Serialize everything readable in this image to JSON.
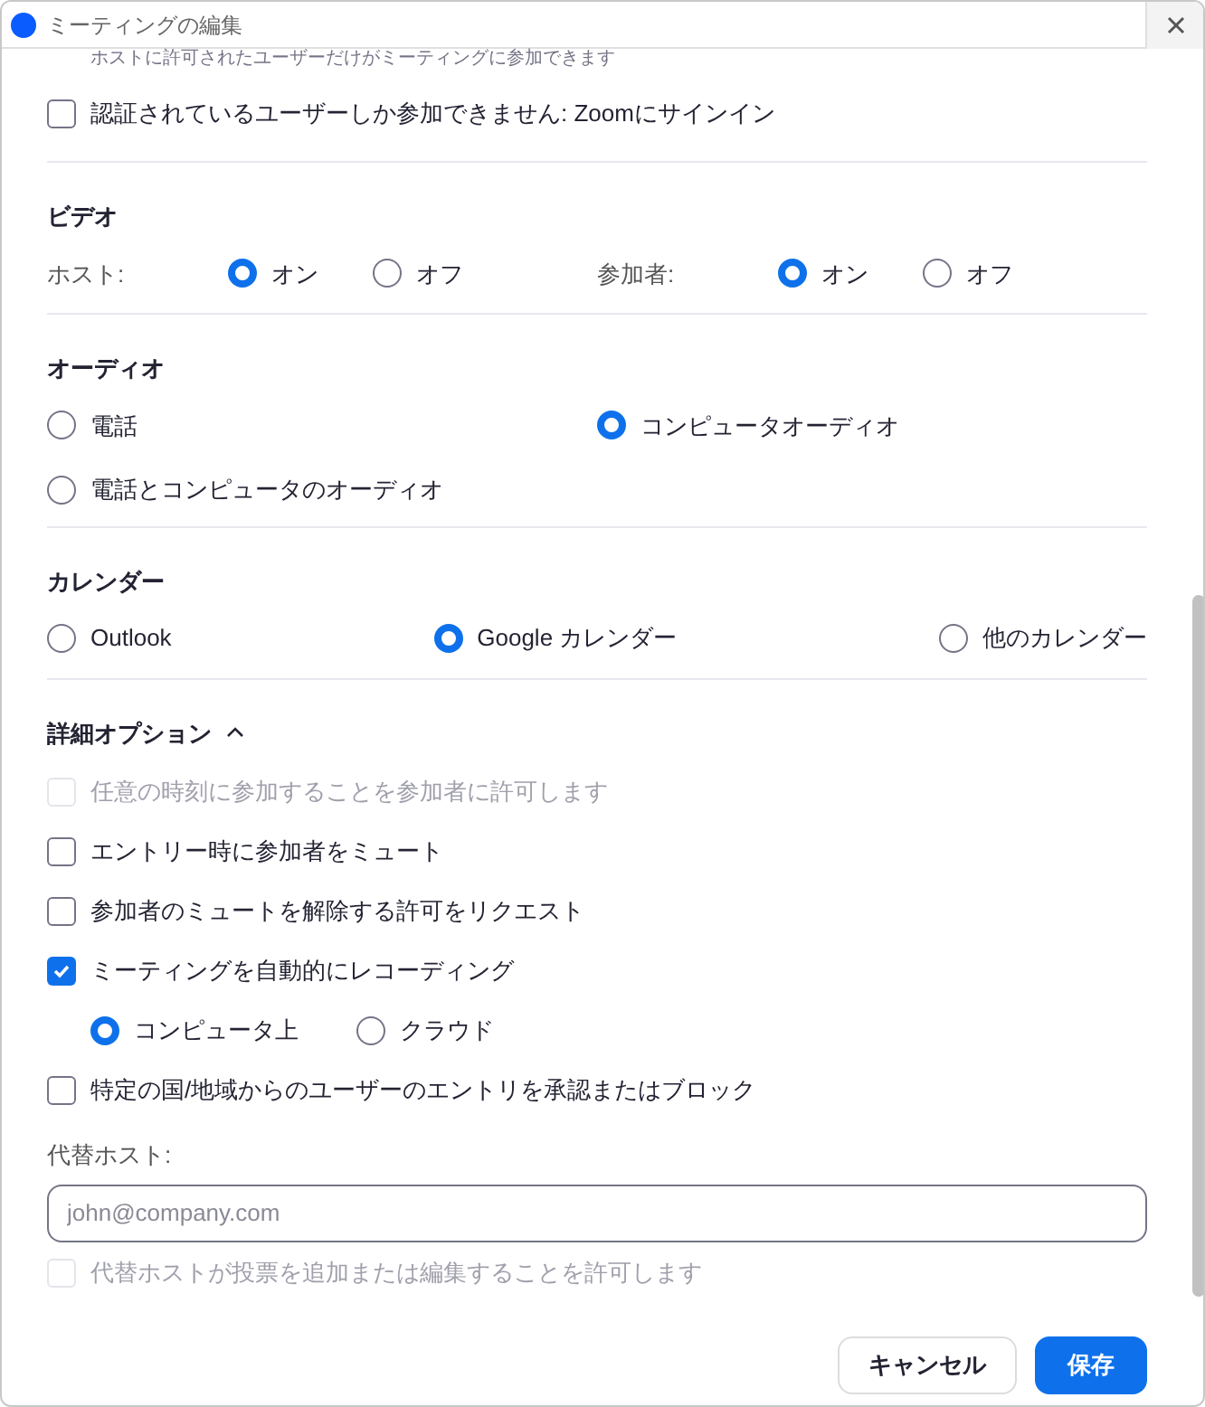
{
  "window": {
    "title": "ミーティングの編集"
  },
  "top_note": "ホストに許可されたユーザーだけがミーティングに参加できます",
  "auth_option": {
    "label": "認証されているユーザーしか参加できません: Zoomにサインイン",
    "checked": false,
    "disabled": false
  },
  "video": {
    "title": "ビデオ",
    "groups": [
      {
        "label": "ホスト:",
        "options": [
          {
            "label": "オン",
            "selected": true
          },
          {
            "label": "オフ",
            "selected": false
          }
        ]
      },
      {
        "label": "参加者:",
        "options": [
          {
            "label": "オン",
            "selected": true
          },
          {
            "label": "オフ",
            "selected": false
          }
        ]
      }
    ]
  },
  "audio": {
    "title": "オーディオ",
    "options": [
      {
        "label": "電話",
        "selected": false
      },
      {
        "label": "コンピュータオーディオ",
        "selected": true
      },
      {
        "label": "電話とコンピュータのオーディオ",
        "selected": false
      }
    ]
  },
  "calendar": {
    "title": "カレンダー",
    "options": [
      {
        "label": "Outlook",
        "selected": false
      },
      {
        "label": "Google カレンダー",
        "selected": true
      },
      {
        "label": "他のカレンダー",
        "selected": false
      }
    ]
  },
  "advanced": {
    "title": "詳細オプション",
    "expanded": true,
    "options": [
      {
        "kind": "checkbox",
        "label": "任意の時刻に参加することを参加者に許可します",
        "checked": false,
        "disabled": true
      },
      {
        "kind": "checkbox",
        "label": "エントリー時に参加者をミュート",
        "checked": false,
        "disabled": false
      },
      {
        "kind": "checkbox",
        "label": "参加者のミュートを解除する許可をリクエスト",
        "checked": false,
        "disabled": false
      },
      {
        "kind": "checkbox",
        "label": "ミーティングを自動的にレコーディング",
        "checked": true,
        "disabled": false
      },
      {
        "kind": "radios",
        "options": [
          {
            "label": "コンピュータ上",
            "selected": true
          },
          {
            "label": "クラウド",
            "selected": false
          }
        ]
      },
      {
        "kind": "checkbox",
        "label": "特定の国/地域からのユーザーのエントリを承認またはブロック",
        "checked": false,
        "disabled": false
      }
    ]
  },
  "alt_host": {
    "label": "代替ホスト:",
    "placeholder": "john@company.com",
    "option": {
      "label": "代替ホストが投票を追加または編集することを許可します",
      "checked": false,
      "disabled": true
    }
  },
  "buttons": [
    {
      "label": "キャンセル",
      "kind": "secondary"
    },
    {
      "label": "保存",
      "kind": "primary"
    }
  ]
}
